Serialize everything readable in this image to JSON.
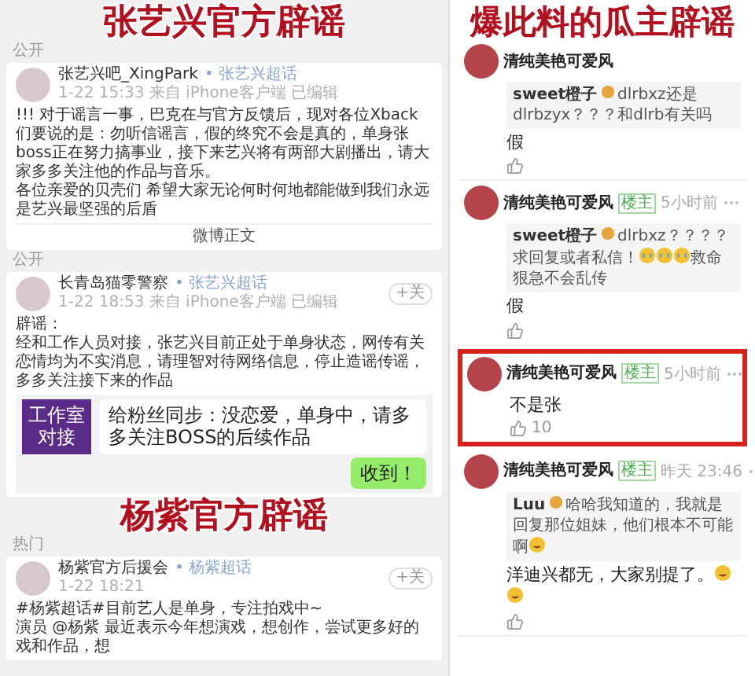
{
  "left": {
    "blocks": [
      {
        "kind": "caption",
        "text": "张艺兴官方辟谣"
      },
      {
        "kind": "tag",
        "text": "公开"
      },
      {
        "kind": "post",
        "name": "张艺兴吧_XingPark",
        "topic": "• 张艺兴超话",
        "meta": "1-22 15:33 来自 iPhone客户端 已编辑",
        "body": [
          "!!! 对于谣言一事，巴克在与官方反馈后，现对各位Xback们要说的是：勿听信谣言，假的终究不会是真的，单身张boss正在努力搞事业，接下来艺兴将有两部大剧播出，请大家多多关注他的作品与音乐。",
          "各位亲爱的贝壳们 希望大家无论何时何地都能做到我们永远是艺兴最坚强的后盾"
        ],
        "link": "微博正文"
      },
      {
        "kind": "tag",
        "text": "公开"
      },
      {
        "kind": "post",
        "name": "长青岛猫零警察",
        "topic": "• 张艺兴超话",
        "meta": "1-22 18:53 来自 iPhone客户端 已编辑",
        "follow": "+关",
        "body": [
          "辟谣：",
          "经和工作人员对接，张艺兴目前正处于单身状态，网传有关恋情均为不实消息，请理智对待网络信息，停止造谣传谣，多多关注接下来的作品"
        ],
        "chat": {
          "label": "工作室对接",
          "message": "给粉丝同步：没恋爱，单身中，请多多关注BOSS的后续作品",
          "reply": "收到！"
        }
      },
      {
        "kind": "caption",
        "text": "杨紫官方辟谣"
      },
      {
        "kind": "tag",
        "text": "热门"
      },
      {
        "kind": "post",
        "name": "杨紫官方后援会",
        "topic": "• 杨紫超话",
        "meta": "1-22 18:21",
        "follow": "+关",
        "body": [
          "#杨紫超话#目前艺人是单身，专注拍戏中~",
          "演员 @杨紫 最近表示今年想演戏，想创作，尝试更多好的戏和作品，想"
        ]
      }
    ]
  },
  "right": {
    "caption": "爆此料的瓜主辟谣",
    "comments": [
      {
        "name": "清纯美艳可爱风",
        "highlighted": false,
        "quote": {
          "user": "sweet橙子",
          "parts": [
            {
              "kind": "text",
              "text": "dlrbxz还是dlrbzyx？？？和dlrb有关吗"
            }
          ]
        },
        "body": [
          {
            "kind": "text",
            "text": "假"
          }
        ]
      },
      {
        "name": "清纯美艳可爱风",
        "badge": "楼主",
        "time": "5小时前",
        "highlighted": false,
        "quote": {
          "user": "sweet橙子",
          "parts": [
            {
              "kind": "text",
              "text": "dlrbxz？？？？求回复或者私信！"
            },
            {
              "kind": "crying-emoji"
            },
            {
              "kind": "crying-emoji"
            },
            {
              "kind": "crying-emoji"
            },
            {
              "kind": "text",
              "text": "救命狠急不会乱传"
            }
          ]
        },
        "body": [
          {
            "kind": "text",
            "text": "假"
          }
        ]
      },
      {
        "name": "清纯美艳可爱风",
        "badge": "楼主",
        "time": "5小时前",
        "highlighted": true,
        "body": [
          {
            "kind": "text",
            "text": "不是张"
          }
        ],
        "likes": "10"
      },
      {
        "name": "清纯美艳可爱风",
        "badge": "楼主",
        "time": "昨天 23:46",
        "highlighted": false,
        "quote": {
          "user": "Luu",
          "parts": [
            {
              "kind": "text",
              "text": "哈哈我知道的，我就是回复那位姐妹，他们根本不可能啊"
            },
            {
              "kind": "laughing-emoji"
            }
          ]
        },
        "body": [
          {
            "kind": "text",
            "text": "洋迪兴都无，大家别提了。"
          },
          {
            "kind": "laughing-emoji"
          },
          {
            "kind": "laughing-emoji"
          }
        ]
      }
    ]
  }
}
